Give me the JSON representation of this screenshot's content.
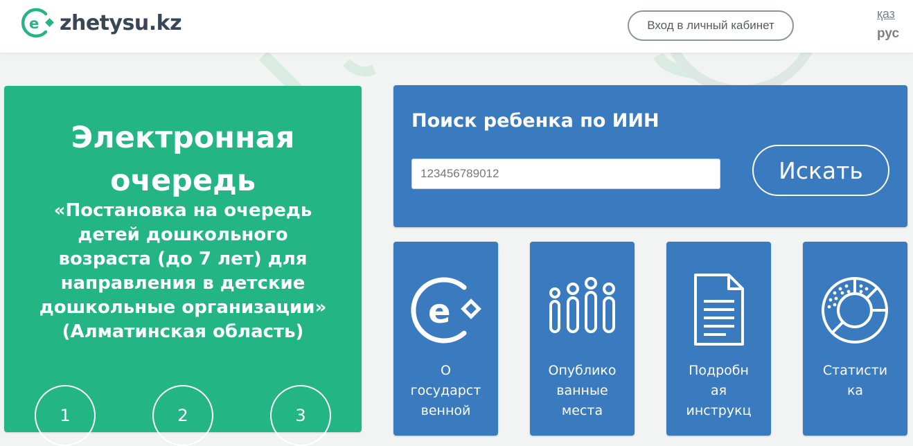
{
  "header": {
    "logo_text": "zhetysu.kz",
    "login_label": "Вход в личный кабинет",
    "lang_kaz": "қаз",
    "lang_rus": "рус"
  },
  "hero": {
    "title_line1": "Электронная",
    "title_line2": "очередь",
    "subtitle_lines": [
      "«Постановка на очередь",
      "детей дошкольного",
      "возраста (до 7 лет) для",
      "направления в детские",
      "дошкольные организации»",
      "(Алматинская область)"
    ],
    "steps": [
      "1",
      "2",
      "3"
    ]
  },
  "search": {
    "title": "Поиск ребенка по ИИН",
    "input_value": "",
    "placeholder": "123456789012",
    "button_label": "Искать"
  },
  "tiles": [
    {
      "icon": "e-logo-icon",
      "label_lines": [
        "О",
        "государст",
        "венной"
      ]
    },
    {
      "icon": "people-icon",
      "label_lines": [
        "Опублико",
        "ванные",
        "места"
      ]
    },
    {
      "icon": "document-icon",
      "label_lines": [
        "Подробн",
        "ая",
        "инструкц"
      ]
    },
    {
      "icon": "pie-chart-icon",
      "label_lines": [
        "Статисти",
        "ка"
      ]
    }
  ],
  "colors": {
    "green": "#24b585",
    "blue": "#3a7bbf",
    "logo_green": "#25b585",
    "text_dark": "#3a4654"
  }
}
